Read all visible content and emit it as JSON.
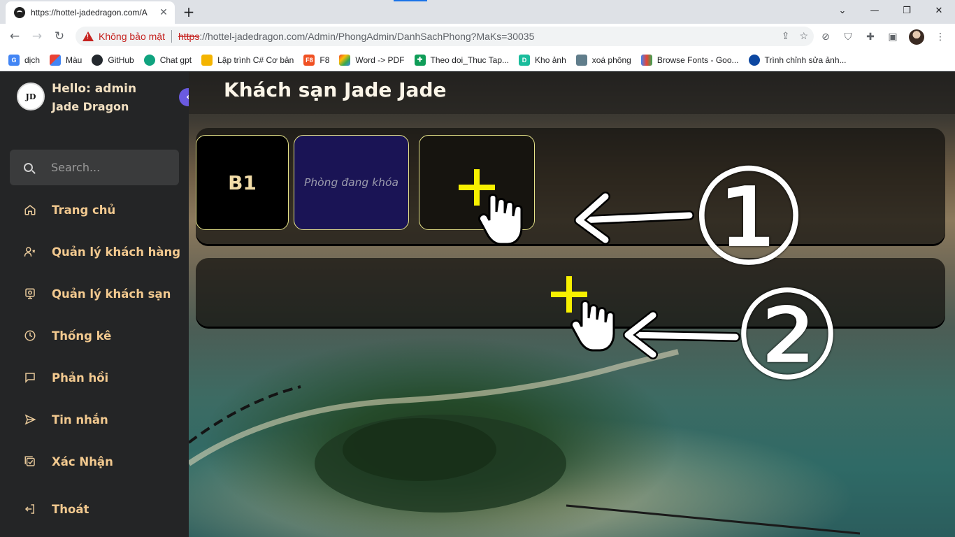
{
  "browser": {
    "tab_title": "https://hottel-jadedragon.com/A",
    "security_label": "Không bảo mật",
    "url_protocol": "https",
    "url_rest": "://hottel-jadedragon.com/Admin/PhongAdmin/DanhSachPhong?MaKs=30035"
  },
  "bookmarks": [
    {
      "label": "dịch",
      "icon": "google-translate-icon",
      "color": "#4285f4"
    },
    {
      "label": "Màu",
      "icon": "color-palette-icon",
      "color": "#e94235"
    },
    {
      "label": "GitHub",
      "icon": "github-icon",
      "color": "#24292e"
    },
    {
      "label": "Chat gpt",
      "icon": "chatgpt-icon",
      "color": "#10a37f"
    },
    {
      "label": "Lập trình C# Cơ bản",
      "icon": "csharp-icon",
      "color": "#f4b400"
    },
    {
      "label": "F8",
      "icon": "f8-icon",
      "color": "#f05123"
    },
    {
      "label": "Word -> PDF",
      "icon": "word-pdf-icon",
      "color": "#a142f4"
    },
    {
      "label": "Theo doi_Thuc Tap...",
      "icon": "sheets-icon",
      "color": "#0f9d58"
    },
    {
      "label": "Kho ảnh",
      "icon": "photo-store-icon",
      "color": "#1abc9c"
    },
    {
      "label": "xoá phông",
      "icon": "remove-bg-icon",
      "color": "#607d8b"
    },
    {
      "label": "Browse Fonts - Goo...",
      "icon": "google-fonts-icon",
      "color": "#4285f4"
    },
    {
      "label": "Trình chỉnh sửa ảnh...",
      "icon": "photo-editor-icon",
      "color": "#0d47a1"
    }
  ],
  "sidebar": {
    "greeting": "Hello: admin",
    "brand": "Jade Dragon",
    "search_placeholder": "Search...",
    "items": [
      {
        "label": "Trang chủ",
        "icon": "home-icon"
      },
      {
        "label": "Quản lý khách hàng",
        "icon": "user-x-icon"
      },
      {
        "label": "Quản lý khách sạn",
        "icon": "hotel-icon"
      },
      {
        "label": "Thống kê",
        "icon": "pie-chart-icon"
      },
      {
        "label": "Phản hồi",
        "icon": "message-square-icon"
      },
      {
        "label": "Tin nhắn",
        "icon": "send-icon"
      },
      {
        "label": "Xác Nhận",
        "icon": "check-square-icon"
      },
      {
        "label": "Thoát",
        "icon": "logout-icon"
      }
    ]
  },
  "main": {
    "title": "Khách sạn Jade Jade",
    "rooms": [
      {
        "label": "B1"
      },
      {
        "label": "Phòng đang khóa"
      }
    ],
    "annotations": [
      "①",
      "②"
    ]
  },
  "colors": {
    "accent": "#6a5ae0",
    "menu_text": "#f2c98f",
    "plus": "#f7f000",
    "locked_room": "#1a1455"
  }
}
